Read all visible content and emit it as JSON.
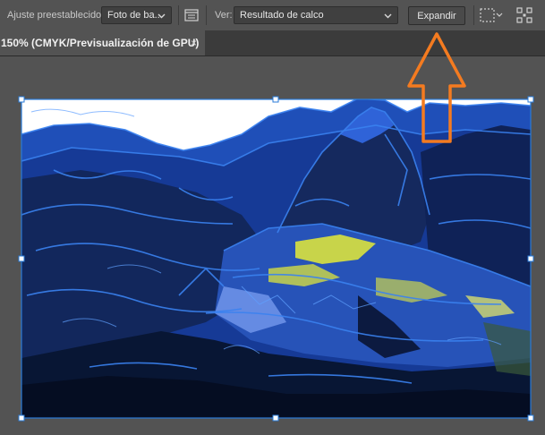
{
  "control_bar": {
    "preset_label": "Ajuste preestablecido:",
    "preset_value": "Foto de ba...",
    "view_label": "Ver:",
    "view_value": "Resultado de calco",
    "expand_label": "Expandir"
  },
  "document_tab": {
    "title": "150% (CMYK/Previsualización de GPU)",
    "close_glyph": "×"
  },
  "colors": {
    "selection": "#2a7bd8",
    "annotation_arrow": "#f47b20",
    "sky": "#ffffff",
    "trace_blue": "#2d6fe0",
    "shadow_navy": "#0d1b3e",
    "terrace_yellow": "#c8d44a"
  },
  "icons": [
    "trace-panel-icon",
    "chevron-down-icon",
    "selection-bounds-icon",
    "grid-icon",
    "close-icon",
    "orange-arrow-up"
  ]
}
